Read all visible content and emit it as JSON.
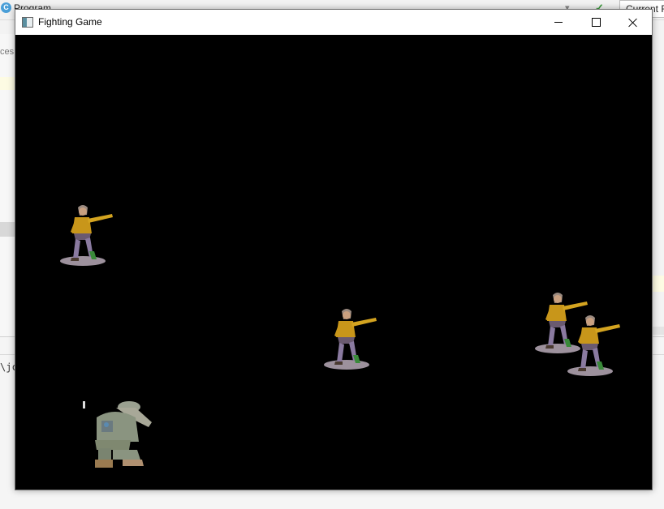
{
  "ide": {
    "app_title": "Program",
    "logo_letter": "C",
    "side_text": "ces",
    "current_button": "Current F",
    "console_text": "\\jc"
  },
  "window": {
    "title": "Fighting Game",
    "minimize": "minimize",
    "maximize": "maximize",
    "close": "close"
  },
  "game": {
    "background_color": "#000000",
    "enemy_color_shirt": "#c8961a",
    "enemy_color_pants": "#8a7aa0",
    "player_color_camo": "#8a9480",
    "enemy_count": 4,
    "player_count": 1
  }
}
